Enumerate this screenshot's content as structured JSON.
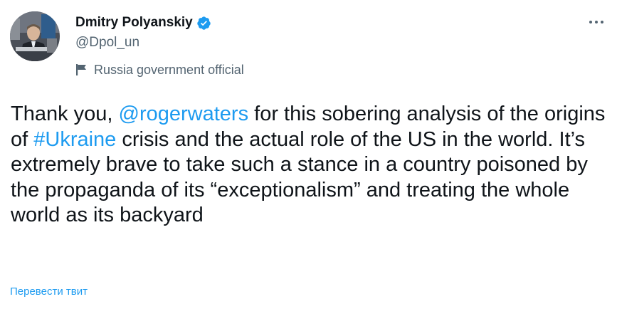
{
  "author": {
    "display_name": "Dmitry Polyanskiy",
    "handle": "@Dpol_un",
    "label": "Russia government official",
    "verified": true
  },
  "tweet": {
    "segments": [
      {
        "type": "text",
        "text": "Thank you, "
      },
      {
        "type": "mention",
        "text": "@rogerwaters"
      },
      {
        "type": "text",
        "text": " for this sobering analysis of the origins of "
      },
      {
        "type": "hashtag",
        "text": "#Ukraine"
      },
      {
        "type": "text",
        "text": " crisis and the actual role of the US in the world. It’s extremely brave to take such a stance in a country poisoned by the propaganda of its “exceptionalism” and treating the whole world as its backyard"
      }
    ]
  },
  "actions": {
    "translate_label": "Перевести твит"
  },
  "icons": {
    "verified": "verified-badge-icon",
    "label": "flag-icon",
    "more": "more-dots-icon"
  },
  "colors": {
    "accent": "#1d9bf0",
    "text": "#0f1419",
    "secondary": "#536471"
  }
}
